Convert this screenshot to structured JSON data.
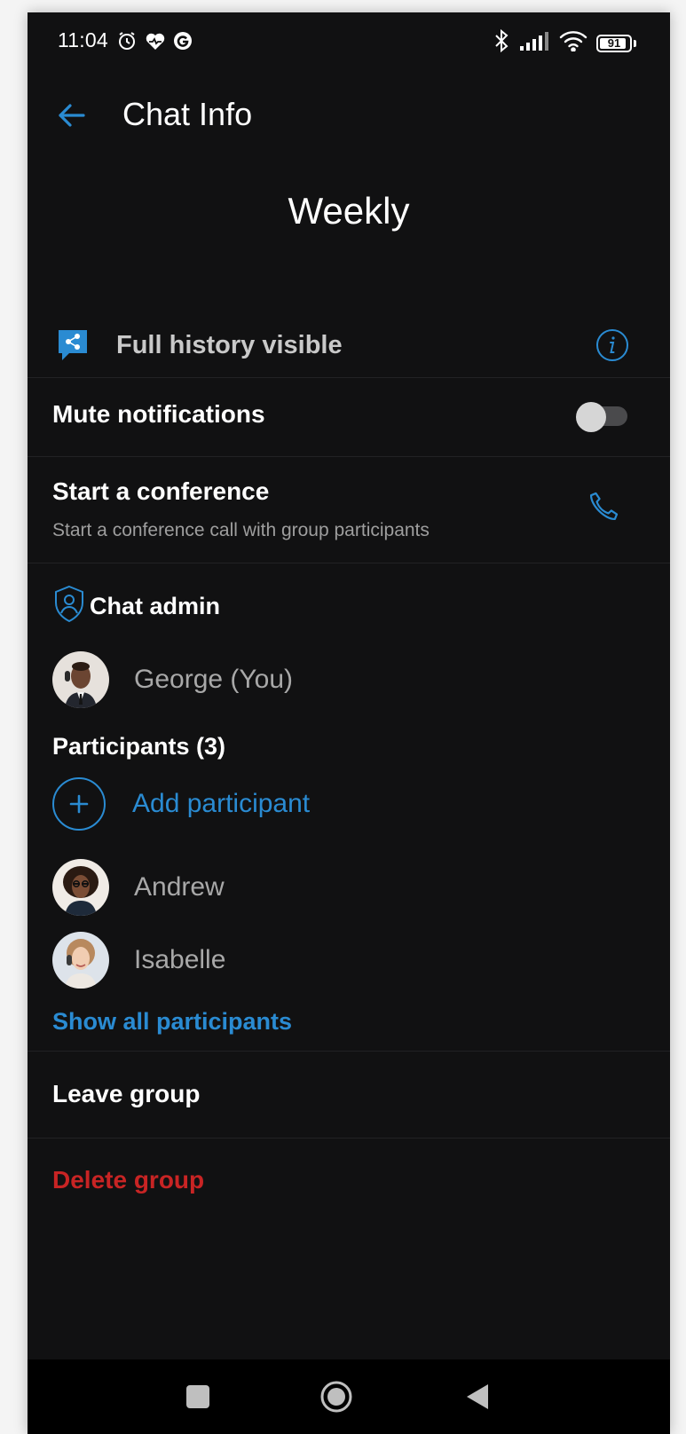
{
  "status_bar": {
    "time": "11:04",
    "battery": "91",
    "battery_level": 0.91
  },
  "app_bar": {
    "title": "Chat Info"
  },
  "group": {
    "name": "Weekly"
  },
  "history": {
    "label": "Full history visible"
  },
  "mute": {
    "label": "Mute notifications",
    "enabled": false
  },
  "conference": {
    "title": "Start a conference",
    "subtitle": "Start a conference call with group participants"
  },
  "admin": {
    "header": "Chat admin",
    "name": "George (You)"
  },
  "participants": {
    "header": "Participants (3)",
    "add_label": "Add participant",
    "members": [
      {
        "name": "Andrew"
      },
      {
        "name": "Isabelle"
      }
    ],
    "show_all_label": "Show all participants"
  },
  "actions": {
    "leave_label": "Leave group",
    "delete_label": "Delete group"
  },
  "colors": {
    "accent": "#2a8bd2",
    "danger": "#c82424",
    "background": "#111112"
  }
}
